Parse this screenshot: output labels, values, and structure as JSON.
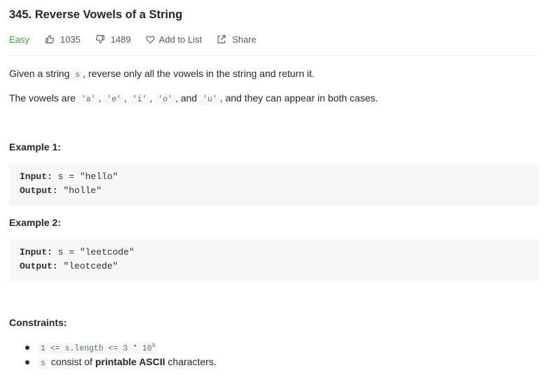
{
  "problem": {
    "title": "345. Reverse Vowels of a String",
    "difficulty": "Easy",
    "likes": "1035",
    "dislikes": "1489",
    "add_to_list": "Add to List",
    "share": "Share",
    "colors": {
      "easy": "#43a047",
      "text": "#262626",
      "muted": "#595959",
      "code_bg": "#f7f7f7"
    }
  },
  "description": {
    "p1_pre": "Given a string ",
    "p1_code": "s",
    "p1_post": ", reverse only all the vowels in the string and return it.",
    "p2_pre": "The vowels are ",
    "v1": "'a'",
    "sep1": ", ",
    "v2": "'e'",
    "sep2": ", ",
    "v3": "'i'",
    "sep3": ", ",
    "v4": "'o'",
    "sep4": ", and ",
    "v5": "'u'",
    "p2_post": ", and they can appear in both cases."
  },
  "examples": [
    {
      "heading": "Example 1:",
      "input_label": "Input:",
      "input_value": " s = \"hello\"",
      "output_label": "Output:",
      "output_value": " \"holle\""
    },
    {
      "heading": "Example 2:",
      "input_label": "Input:",
      "input_value": " s = \"leetcode\"",
      "output_label": "Output:",
      "output_value": " \"leotcede\""
    }
  ],
  "constraints": {
    "heading": "Constraints:",
    "c1_code": "1 <= s.length <= 3 * 10",
    "c1_sup": "5",
    "c2_code": "s",
    "c2_pre": " consist of ",
    "c2_bold": "printable ASCII",
    "c2_post": " characters."
  },
  "icons": [
    "thumbs-up-icon",
    "thumbs-down-icon",
    "heart-icon",
    "share-icon"
  ]
}
